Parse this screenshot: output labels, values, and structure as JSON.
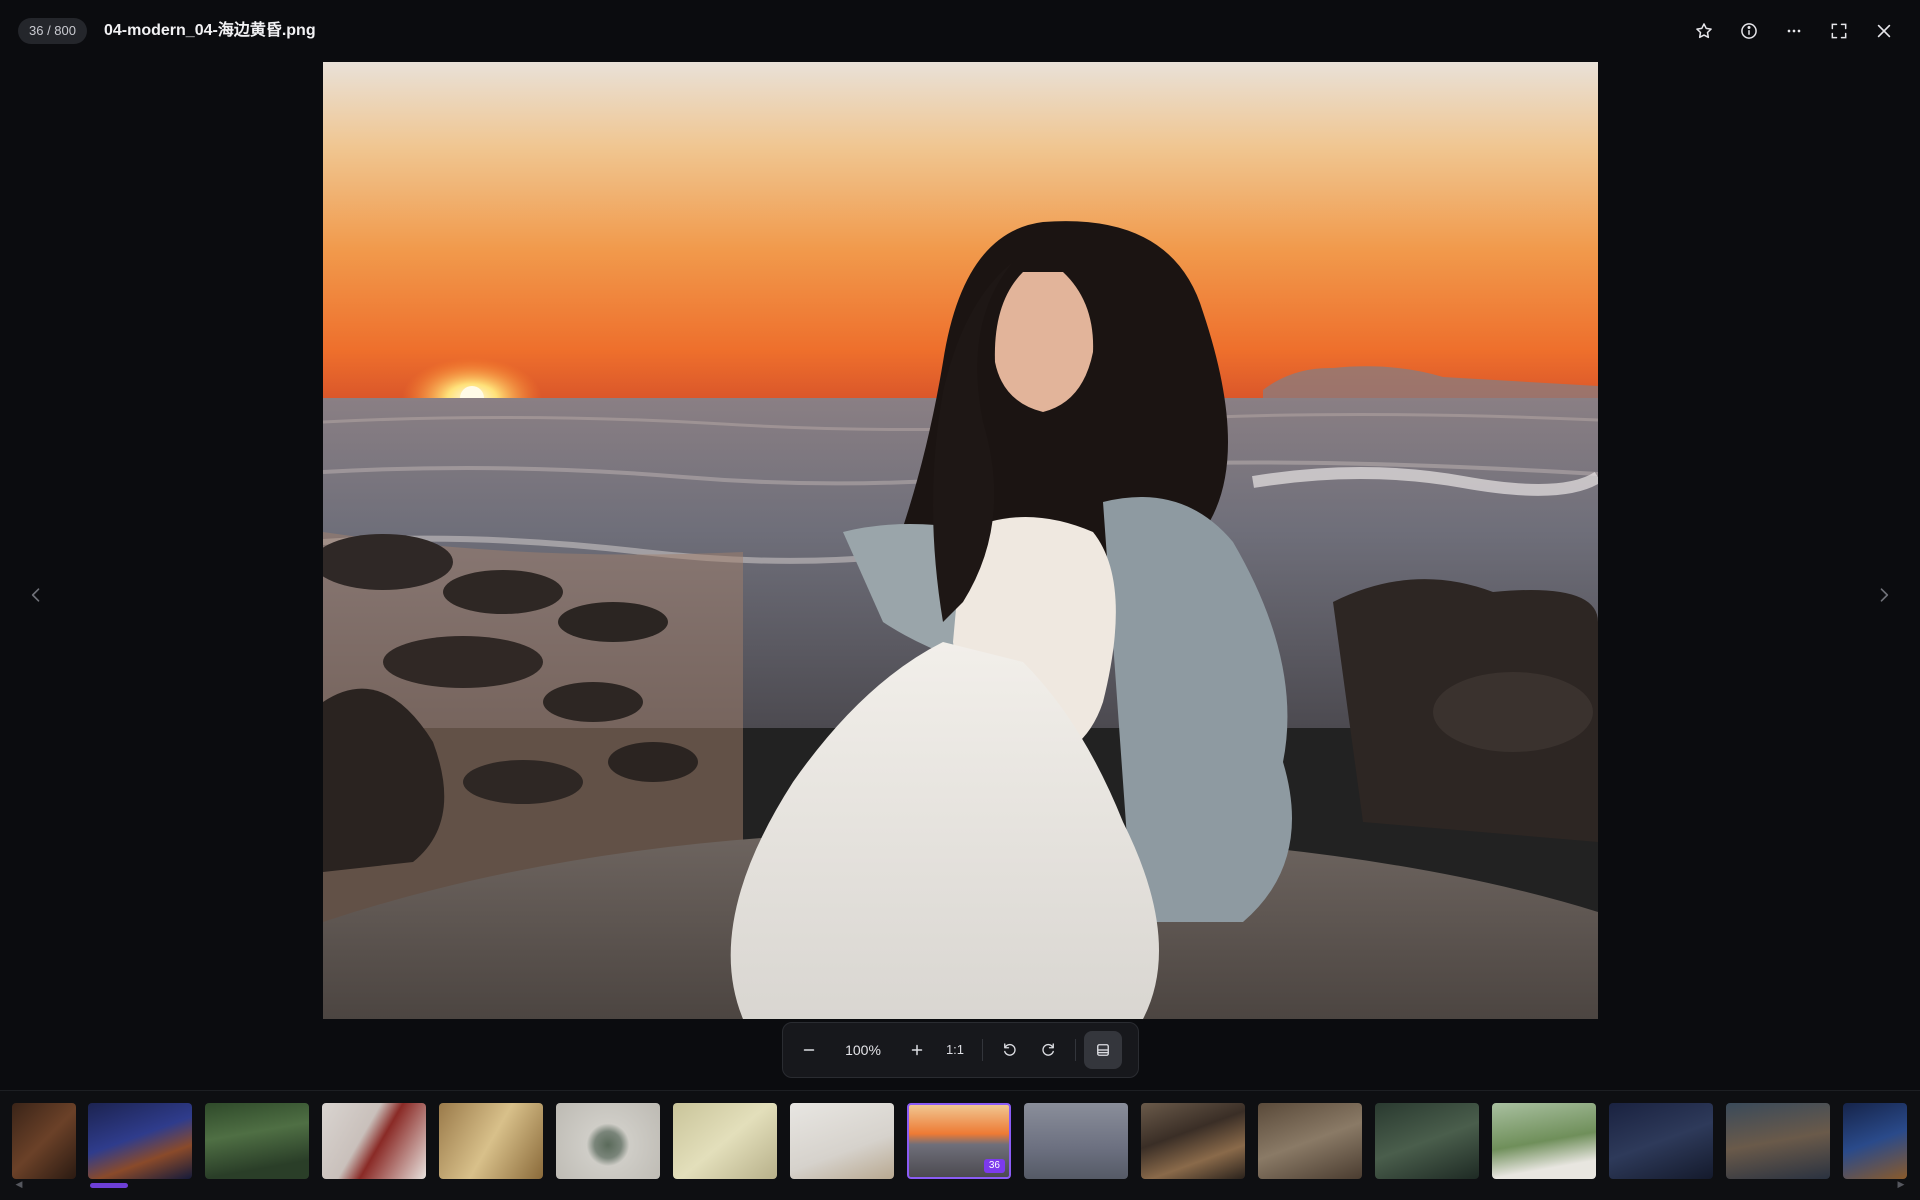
{
  "viewer": {
    "counter": "36 / 800",
    "filename": "04-modern_04-海边黄昏.png"
  },
  "top_actions": [
    {
      "name": "favorite-star-icon"
    },
    {
      "name": "info-icon"
    },
    {
      "name": "more-icon"
    },
    {
      "name": "fullscreen-icon"
    },
    {
      "name": "close-icon"
    }
  ],
  "zoom": {
    "value": "100%",
    "one_to_one": "1:1"
  },
  "filmstrip": {
    "current_badge": "36",
    "current_index": 8,
    "thumbnail_count": 16
  },
  "colors": {
    "accent": "#7c3aed",
    "background": "#0b0c0f"
  }
}
